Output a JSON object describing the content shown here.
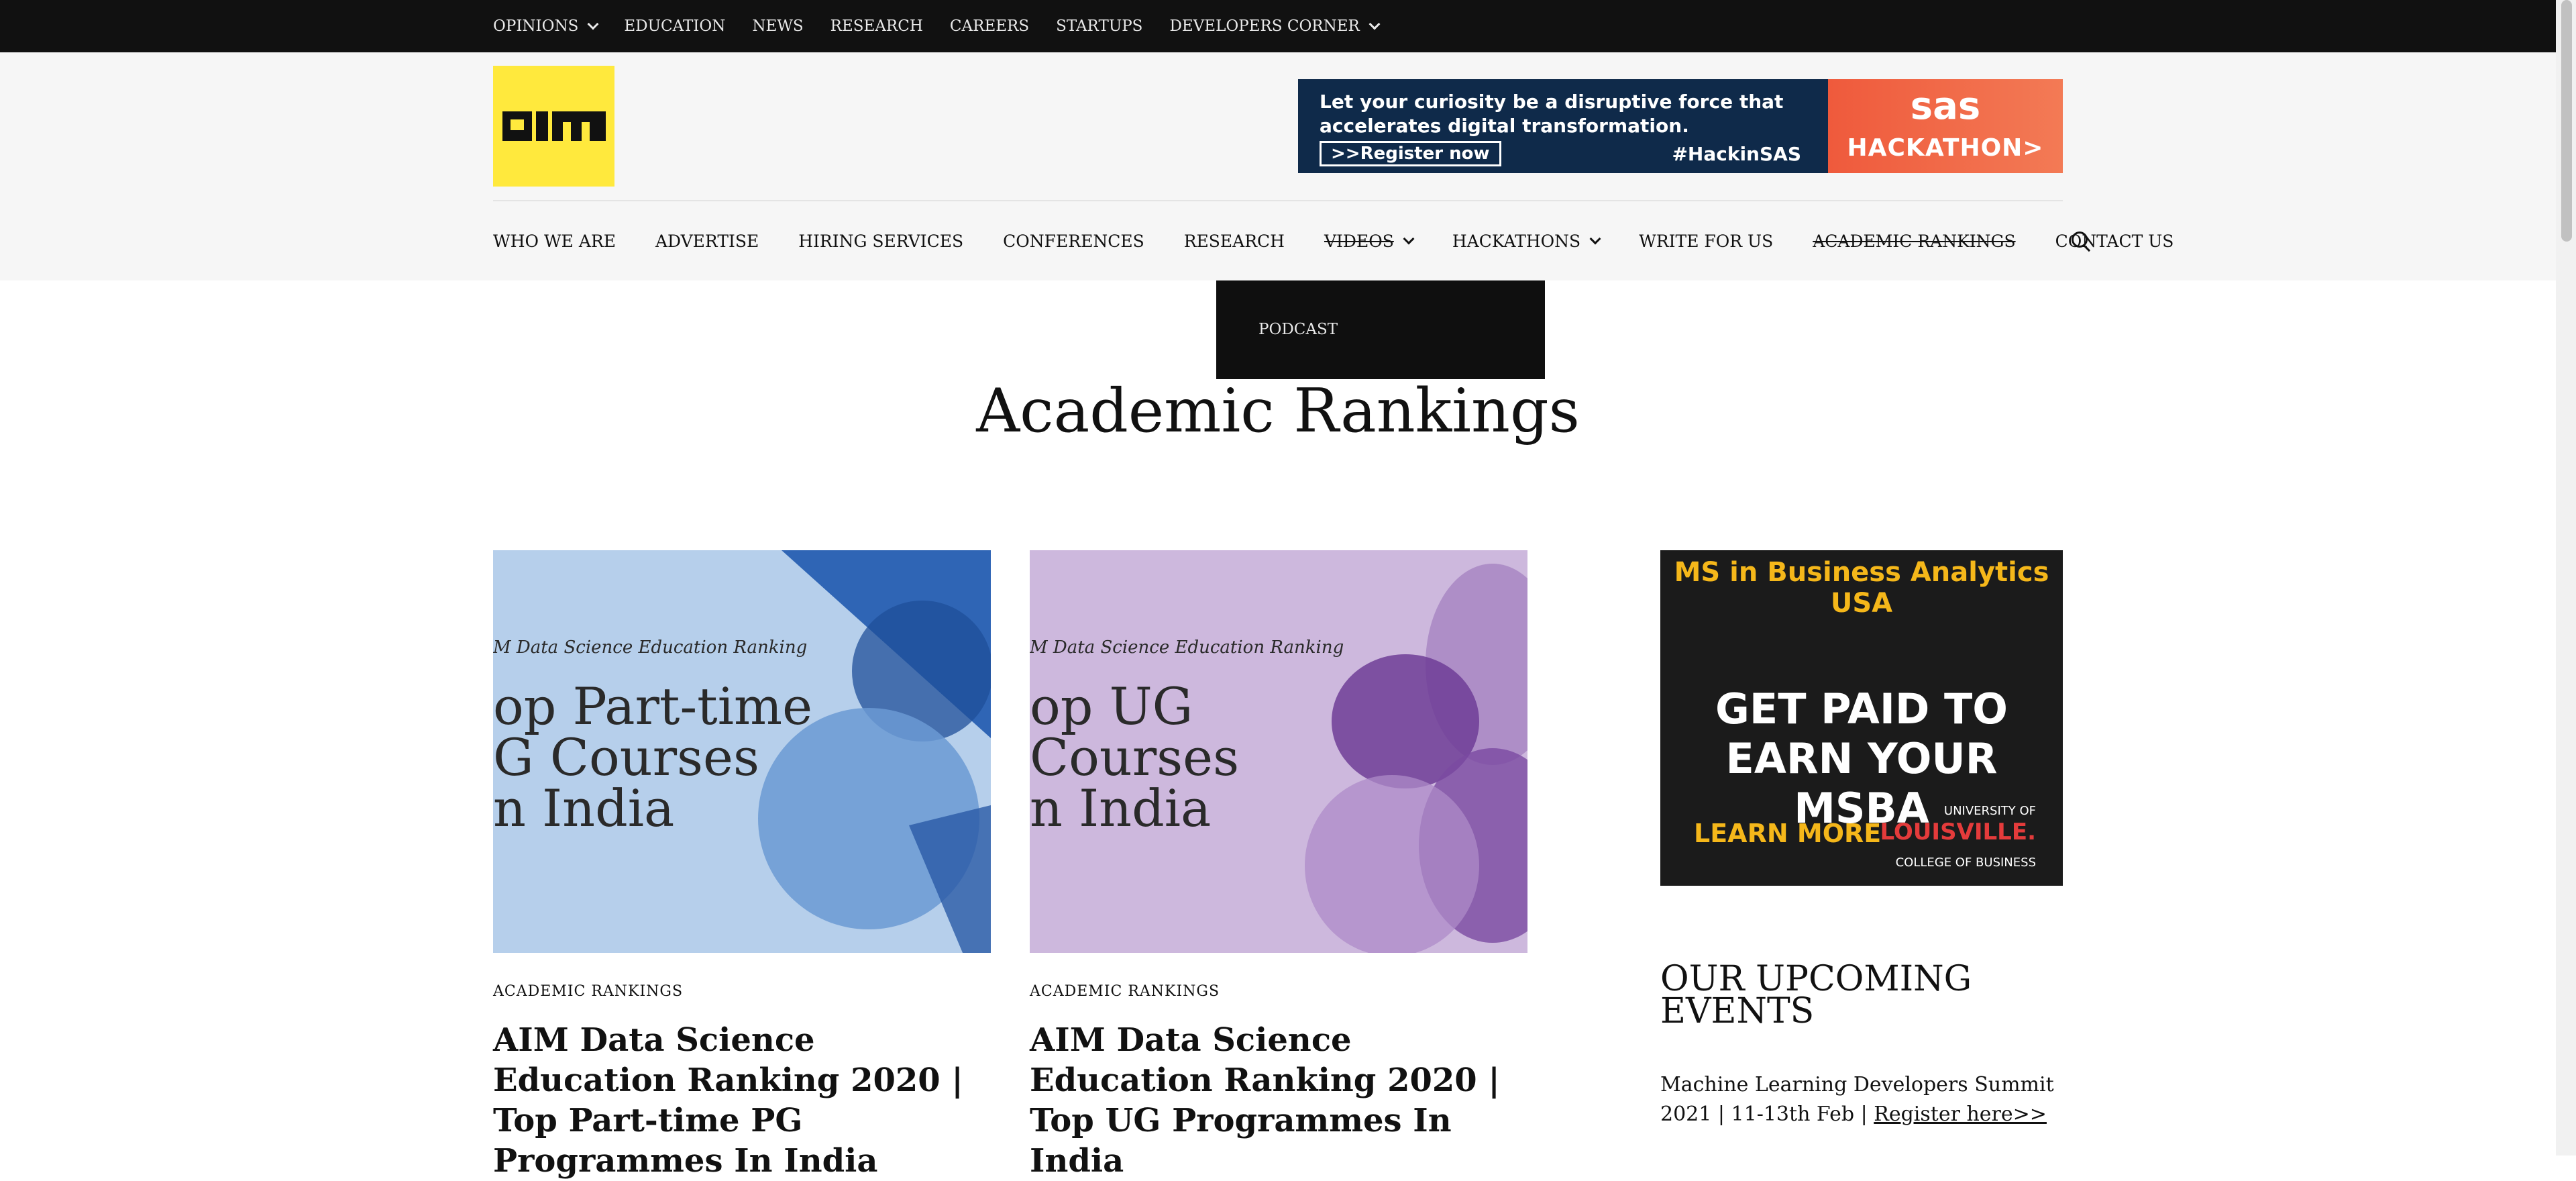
{
  "topnav": {
    "items": [
      {
        "label": "OPINIONS",
        "dropdown": true
      },
      {
        "label": "EDUCATION"
      },
      {
        "label": "NEWS"
      },
      {
        "label": "RESEARCH"
      },
      {
        "label": "CAREERS"
      },
      {
        "label": "STARTUPS"
      },
      {
        "label": "DEVELOPERS CORNER",
        "dropdown": true
      }
    ]
  },
  "header": {
    "logo_text": "AIM",
    "banner": {
      "tagline": "Let your curiosity be a disruptive force that accelerates digital transformation.",
      "register_label": ">>Register now",
      "hashtag": "#HackinSAS",
      "brand": "sas",
      "event": "HACKATHON>"
    }
  },
  "mainnav": {
    "items": [
      {
        "label": "WHO WE ARE"
      },
      {
        "label": "ADVERTISE"
      },
      {
        "label": "HIRING SERVICES"
      },
      {
        "label": "CONFERENCES"
      },
      {
        "label": "RESEARCH"
      },
      {
        "label": "VIDEOS"
      },
      {
        "label": "HACKATHONS"
      },
      {
        "label": "WRITE FOR US"
      },
      {
        "label": "ACADEMIC RANKINGS"
      },
      {
        "label": "CONTACT US"
      }
    ],
    "dropdown_item": "PODCAST"
  },
  "page": {
    "title": "Academic Rankings"
  },
  "articles": [
    {
      "thumb_kicker": "M Data Science Education Ranking",
      "thumb_lines": "op Part-time\nG Courses\nn India",
      "category": "ACADEMIC RANKINGS",
      "title": "AIM Data Science Education Ranking 2020 | Top Part-time PG Programmes In India",
      "bg": "#b6cfeb"
    },
    {
      "thumb_kicker": "M Data Science Education Ranking",
      "thumb_lines": "op UG\nCourses\nn India",
      "category": "ACADEMIC RANKINGS",
      "title": "AIM Data Science Education Ranking 2020 | Top UG Programmes In India",
      "bg": "#cdb8dd"
    }
  ],
  "sidebar": {
    "ad": {
      "headline": "MS in Business Analytics USA",
      "main": "GET PAID TO EARN YOUR MSBA",
      "cta": "LEARN MORE",
      "university_of": "UNIVERSITY OF",
      "university": "LOUISVILLE.",
      "college": "COLLEGE OF BUSINESS"
    },
    "events_title": "OUR UPCOMING EVENTS",
    "event_text": "Machine Learning Developers Summit 2021 | 11-13th Feb | ",
    "event_link": "Register here>>"
  }
}
